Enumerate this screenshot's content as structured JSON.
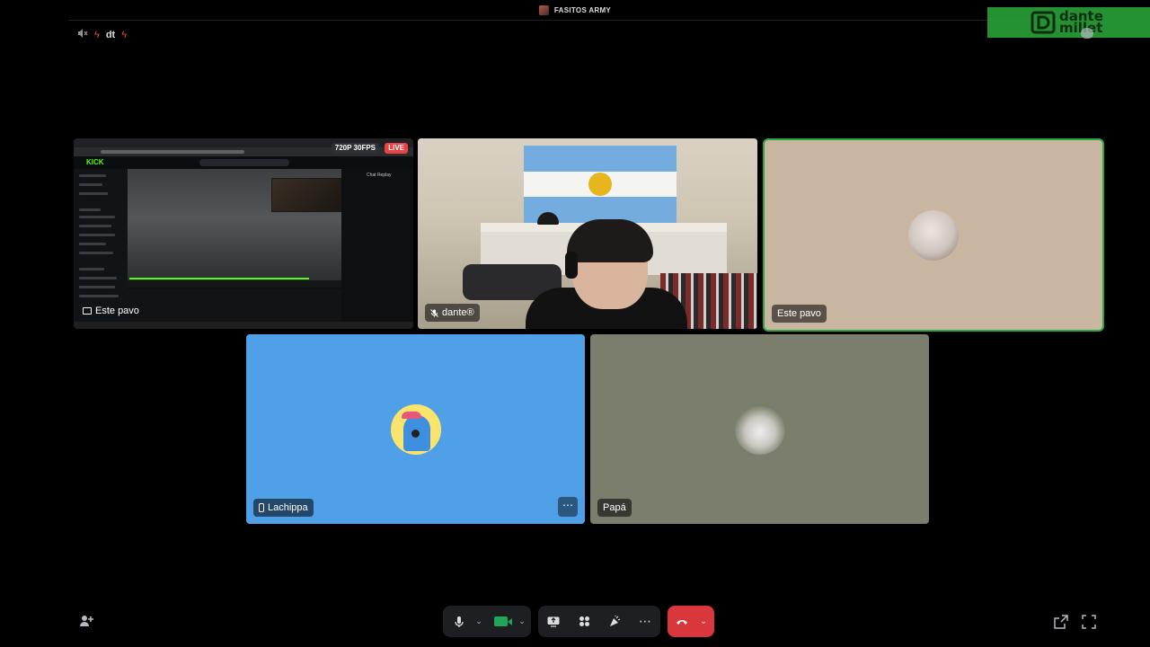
{
  "header": {
    "server_name": "FASITOS ARMY"
  },
  "status_bar": {
    "icons": [
      "speaker-muted-icon",
      "bolt-icon",
      "dt-label",
      "bolt-icon"
    ],
    "dt_text": "dt"
  },
  "watermark": {
    "line1": "dante",
    "line2": "millet"
  },
  "tiles": [
    {
      "id": "stream",
      "label": "Este pavo",
      "type": "screen-share",
      "quality_badge": "720P 30FPS",
      "live_badge": "LIVE",
      "inner_site": "KICK",
      "inner_chat_title": "Chat Replay"
    },
    {
      "id": "camera",
      "label": "dante®",
      "type": "camera"
    },
    {
      "id": "estepavo",
      "label": "Este pavo",
      "type": "avatar",
      "speaking": true
    },
    {
      "id": "lachippa",
      "label": "Lachippa",
      "type": "avatar",
      "mobile": true
    },
    {
      "id": "papa",
      "label": "Papá",
      "type": "avatar"
    }
  ],
  "controls": {
    "more_glyph": "⋯",
    "icons": [
      "invite-icon",
      "microphone-icon",
      "camera-icon",
      "screen-share-icon",
      "activities-icon",
      "soundboard-icon",
      "more-icon",
      "disconnect-icon",
      "popout-icon",
      "fullscreen-icon"
    ]
  },
  "colors": {
    "background": "#000000",
    "speaking_border": "#2aa83e",
    "live": "#ed4245",
    "leave_button": "#da373c",
    "camera_on": "#23a559",
    "lachippa_bg": "#50a0e8",
    "papa_bg": "#7b7d6d",
    "estepavo_bg": "#c8b6a0"
  }
}
